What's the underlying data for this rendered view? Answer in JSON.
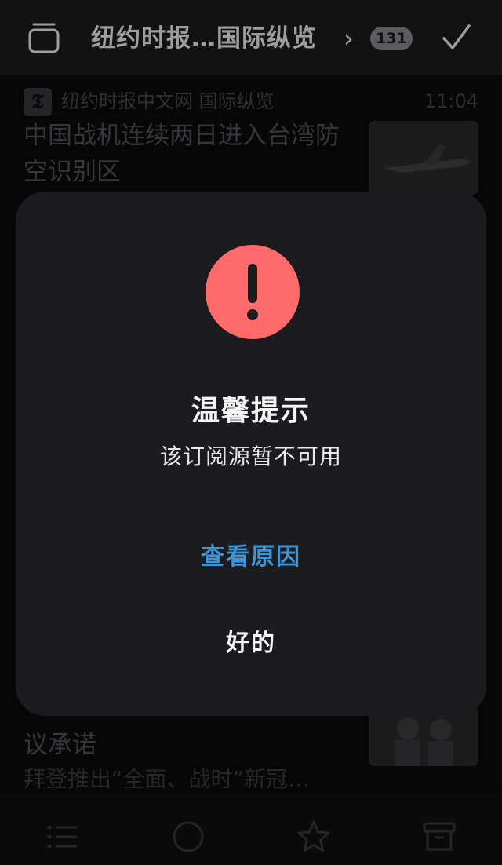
{
  "header": {
    "title": "纽约时报…国际纵览",
    "chevron": "›",
    "unread_count": "131"
  },
  "feed": {
    "item1": {
      "source": "纽约时报中文网 国际纵览",
      "source_logo": "𝕿",
      "time": "11:04",
      "headline": "中国战机连续两日进入台湾防空识别区"
    },
    "item2": {
      "headline": "议承诺",
      "subtitle": "拜登推出“全面、战时”新冠…"
    }
  },
  "toolbar": {
    "icons": [
      "list-icon",
      "circle-icon",
      "star-icon",
      "archive-icon"
    ]
  },
  "modal": {
    "title": "温馨提示",
    "message": "该订阅源暂不可用",
    "reason_button": "查看原因",
    "ok_button": "好的",
    "accent_color": "#3d95d6",
    "alert_color": "#ff6b6b"
  }
}
